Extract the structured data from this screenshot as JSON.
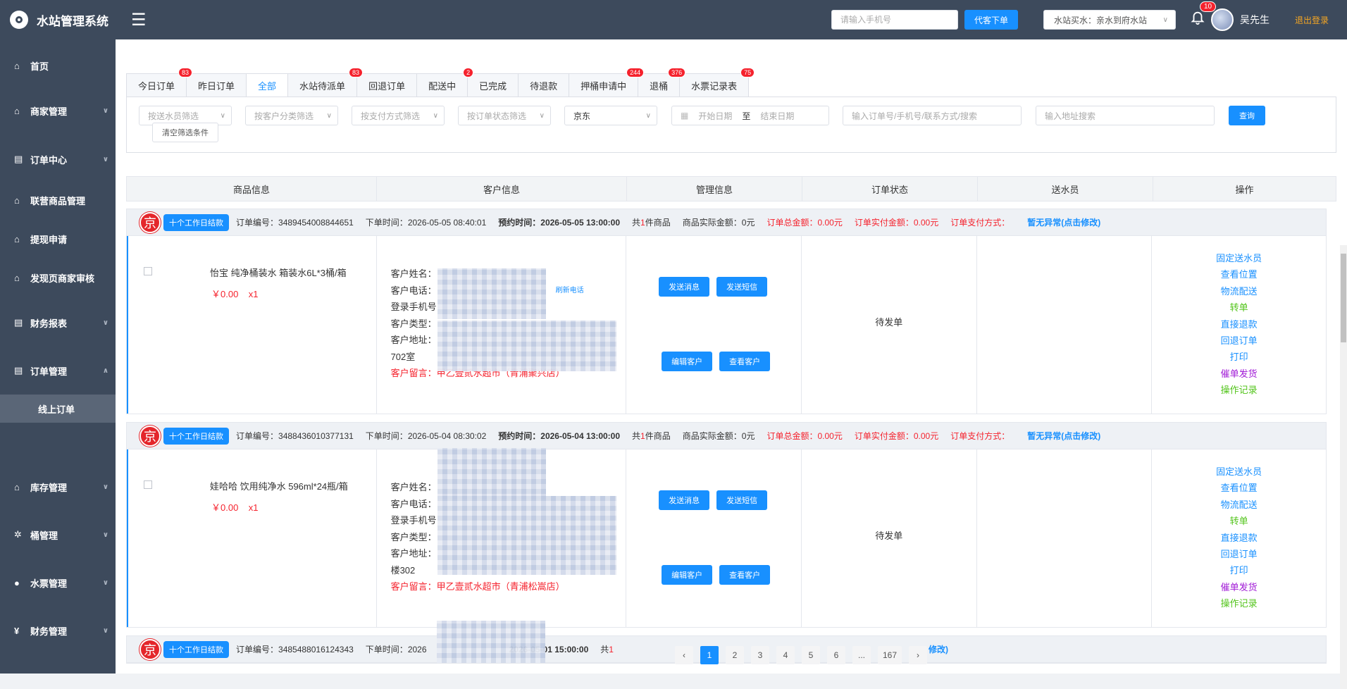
{
  "app": {
    "title": "水站管理系统"
  },
  "header": {
    "phone_placeholder": "请输入手机号",
    "order_for_customer": "代客下单",
    "station_select": "水站买水：亲水到府水站",
    "notifications_count": "10",
    "user_name": "吴先生",
    "logout": "退出登录"
  },
  "sidebar": {
    "items": [
      {
        "label": "首页",
        "icon": "home-icon"
      },
      {
        "label": "商家管理",
        "icon": "home-icon"
      },
      {
        "label": "订单中心",
        "icon": "document-icon"
      },
      {
        "label": "联营商品管理",
        "icon": "home-icon"
      },
      {
        "label": "提现申请",
        "icon": "home-icon"
      },
      {
        "label": "发现页商家审核",
        "icon": "home-icon"
      },
      {
        "label": "财务报表",
        "icon": "document-icon"
      },
      {
        "label": "订单管理",
        "icon": "document-icon"
      },
      {
        "label": "库存管理",
        "icon": "bank-icon"
      },
      {
        "label": "桶管理",
        "icon": "gear-icon"
      },
      {
        "label": "水票管理",
        "icon": "user-icon"
      },
      {
        "label": "财务管理",
        "icon": "yen-icon"
      }
    ],
    "sub_active": "线上订单"
  },
  "tabs": [
    {
      "label": "今日订单",
      "badge": "83"
    },
    {
      "label": "昨日订单",
      "badge": ""
    },
    {
      "label": "全部",
      "badge": "",
      "active": true
    },
    {
      "label": "水站待派单",
      "badge": "83"
    },
    {
      "label": "回退订单",
      "badge": ""
    },
    {
      "label": "配送中",
      "badge": "2"
    },
    {
      "label": "已完成",
      "badge": ""
    },
    {
      "label": "待退款",
      "badge": ""
    },
    {
      "label": "押桶申请中",
      "badge": "244"
    },
    {
      "label": "退桶",
      "badge": "376"
    },
    {
      "label": "水票记录表",
      "badge": "75"
    }
  ],
  "filters": {
    "courier": "按送水员筛选",
    "customer_category": "按客户分类筛选",
    "payment": "按支付方式筛选",
    "order_status": "按订单状态筛选",
    "platform": "京东",
    "start_date": "开始日期",
    "to": "至",
    "end_date": "结束日期",
    "search_placeholder": "输入订单号/手机号/联系方式/搜索",
    "address_placeholder": "输入地址搜索",
    "query": "查询",
    "clear": "清空筛选条件"
  },
  "table_headers": [
    "商品信息",
    "客户信息",
    "管理信息",
    "订单状态",
    "送水员",
    "操作"
  ],
  "order_labels": {
    "tag": "十个工作日结款",
    "order_no": "订单编号：",
    "order_time": "下单时间：",
    "reserve_time": "预约时间：",
    "total_goods_prefix": "共",
    "total_goods_suffix": "件商品",
    "actual_goods_amount": "商品实际金额：",
    "order_total": "订单总金额：",
    "order_paid": "订单实付金额：",
    "pay_method": "订单支付方式：",
    "abnormal": "暂无异常(点击修改)",
    "cust_name": "客户姓名：",
    "cust_phone": "客户电话：",
    "login_phone": "登录手机号",
    "cust_type": "客户类型：",
    "cust_addr": "客户地址：",
    "cust_msg": "客户留言：",
    "refresh_phone": "刷新电话",
    "send_msg": "发送消息",
    "send_sms": "发送短信",
    "edit_cust": "编辑客户",
    "view_cust": "查看客户",
    "ops": [
      "固定送水员",
      "查看位置",
      "物流配送",
      "转单",
      "直接退款",
      "回退订单",
      "打印",
      "催单发货",
      "操作记录"
    ]
  },
  "orders": [
    {
      "order_no": "3489454008844651",
      "order_time": "2026-05-05 08:40:01",
      "reserve_time": "2026-05-05 13:00:00",
      "goods_count": "1",
      "actual_amount": "0元",
      "total": "0.00元",
      "paid": "0.00元",
      "product": "怡宝 纯净桶装水 箱装水6L*3桶/箱",
      "price": "￥0.00",
      "qty": "x1",
      "addr_tail": "702室",
      "message": "甲乙壹贰水超市（青浦聚兴店）",
      "status": "待发单"
    },
    {
      "order_no": "3488436010377131",
      "order_time": "2026-05-04 08:30:02",
      "reserve_time": "2026-05-04 13:00:00",
      "goods_count": "1",
      "actual_amount": "0元",
      "total": "0.00元",
      "paid": "0.00元",
      "product": "娃哈哈 饮用纯净水 596ml*24瓶/箱",
      "price": "￥0.00",
      "qty": "x1",
      "addr_tail": "楼302",
      "message": "甲乙壹贰水超市（青浦松嵩店）",
      "status": "待发单"
    },
    {
      "order_no": "3485488016124343",
      "order_time": "2026",
      "reserve_time": "2026-05-01 15:00:00",
      "goods_count": "1",
      "abnormal_tail": "修改)"
    }
  ],
  "pagination": {
    "pages": [
      "1",
      "2",
      "3",
      "4",
      "5",
      "6",
      "...",
      "167"
    ],
    "current": "1"
  }
}
